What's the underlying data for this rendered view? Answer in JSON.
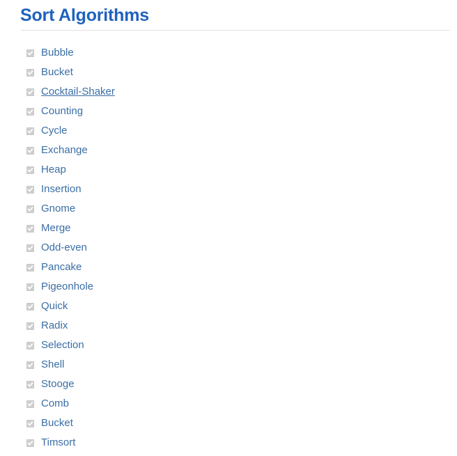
{
  "page": {
    "title": "Sort Algorithms",
    "title_color": "#2062be",
    "rule_color": "#e2e2e2",
    "background": "#ffffff",
    "link_color": "#3a6ea5",
    "checkbox_fill": "#cfcfcf",
    "checkbox_check_color": "#ffffff"
  },
  "list": {
    "checkbox_icon": "checkbox-checked-disabled-icon",
    "checkbox_state": "checked-disabled",
    "item_count": 21,
    "items": [
      {
        "label": "Bubble",
        "checked": true,
        "disabled": true,
        "underlined": false
      },
      {
        "label": "Bucket",
        "checked": true,
        "disabled": true,
        "underlined": false
      },
      {
        "label": "Cocktail-Shaker",
        "checked": true,
        "disabled": true,
        "underlined": true
      },
      {
        "label": "Counting",
        "checked": true,
        "disabled": true,
        "underlined": false
      },
      {
        "label": "Cycle",
        "checked": true,
        "disabled": true,
        "underlined": false
      },
      {
        "label": "Exchange",
        "checked": true,
        "disabled": true,
        "underlined": false
      },
      {
        "label": "Heap",
        "checked": true,
        "disabled": true,
        "underlined": false
      },
      {
        "label": "Insertion",
        "checked": true,
        "disabled": true,
        "underlined": false
      },
      {
        "label": "Gnome",
        "checked": true,
        "disabled": true,
        "underlined": false
      },
      {
        "label": "Merge",
        "checked": true,
        "disabled": true,
        "underlined": false
      },
      {
        "label": "Odd-even",
        "checked": true,
        "disabled": true,
        "underlined": false
      },
      {
        "label": "Pancake",
        "checked": true,
        "disabled": true,
        "underlined": false
      },
      {
        "label": "Pigeonhole",
        "checked": true,
        "disabled": true,
        "underlined": false
      },
      {
        "label": "Quick",
        "checked": true,
        "disabled": true,
        "underlined": false
      },
      {
        "label": "Radix",
        "checked": true,
        "disabled": true,
        "underlined": false
      },
      {
        "label": "Selection",
        "checked": true,
        "disabled": true,
        "underlined": false
      },
      {
        "label": "Shell",
        "checked": true,
        "disabled": true,
        "underlined": false
      },
      {
        "label": "Stooge",
        "checked": true,
        "disabled": true,
        "underlined": false
      },
      {
        "label": "Comb",
        "checked": true,
        "disabled": true,
        "underlined": false
      },
      {
        "label": "Bucket",
        "checked": true,
        "disabled": true,
        "underlined": false
      },
      {
        "label": "Timsort",
        "checked": true,
        "disabled": true,
        "underlined": false
      }
    ]
  }
}
